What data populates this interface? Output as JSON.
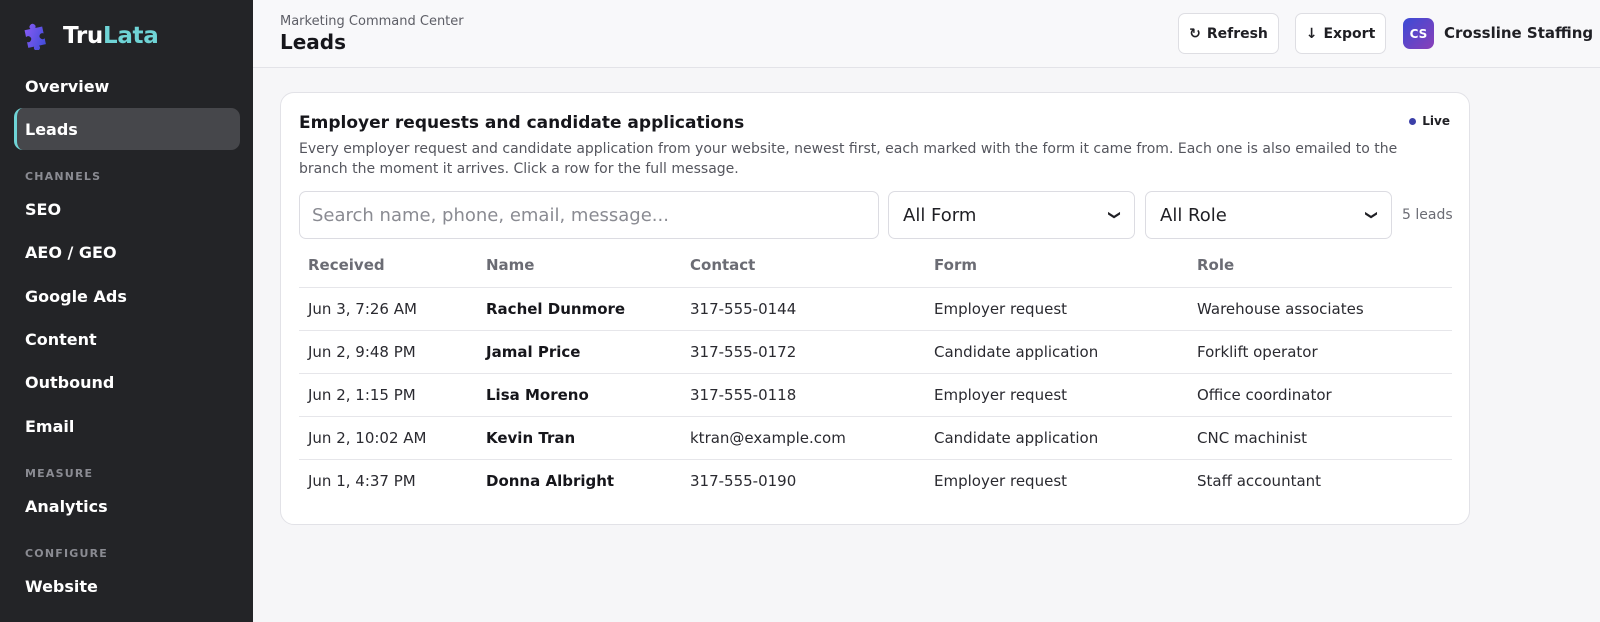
{
  "brand": {
    "name_part1": "Tru",
    "name_part2": "Lata",
    "accent_color": "#6fd4d6"
  },
  "sidebar": {
    "items": [
      {
        "label": "Overview"
      },
      {
        "label": "Leads",
        "active": true
      },
      {
        "label": "SEO"
      },
      {
        "label": "AEO / GEO"
      },
      {
        "label": "Google Ads"
      },
      {
        "label": "Content"
      },
      {
        "label": "Outbound"
      },
      {
        "label": "Email"
      },
      {
        "label": "Analytics"
      },
      {
        "label": "Website"
      }
    ],
    "sections": {
      "channels": "CHANNELS",
      "measure": "MEASURE",
      "configure": "CONFIGURE"
    }
  },
  "header": {
    "breadcrumb": "Marketing Command Center",
    "title": "Leads",
    "refresh_label": "Refresh",
    "export_label": "Export",
    "avatar_initials": "CS",
    "org_name": "Crossline Staffing"
  },
  "card": {
    "title": "Employer requests and candidate applications",
    "live_label": "Live",
    "description": "Every employer request and candidate application from your website, newest first, each marked with the form it came from. Each one is also emailed to the branch the moment it arrives. Click a row for the full message."
  },
  "filters": {
    "search_placeholder": "Search name, phone, email, message...",
    "form_selected": "All Form",
    "role_selected": "All Role",
    "count": "5 leads"
  },
  "table": {
    "headers": [
      "Received",
      "Name",
      "Contact",
      "Form",
      "Role"
    ],
    "rows": [
      {
        "received": "Jun 3, 7:26 AM",
        "name": "Rachel Dunmore",
        "contact": "317-555-0144",
        "form": "Employer request",
        "role": "Warehouse associates"
      },
      {
        "received": "Jun 2, 9:48 PM",
        "name": "Jamal Price",
        "contact": "317-555-0172",
        "form": "Candidate application",
        "role": "Forklift operator"
      },
      {
        "received": "Jun 2, 1:15 PM",
        "name": "Lisa Moreno",
        "contact": "317-555-0118",
        "form": "Employer request",
        "role": "Office coordinator"
      },
      {
        "received": "Jun 2, 10:02 AM",
        "name": "Kevin Tran",
        "contact": "ktran@example.com",
        "form": "Candidate application",
        "role": "CNC machinist"
      },
      {
        "received": "Jun 1, 4:37 PM",
        "name": "Donna Albright",
        "contact": "317-555-0190",
        "form": "Employer request",
        "role": "Staff accountant"
      }
    ]
  }
}
